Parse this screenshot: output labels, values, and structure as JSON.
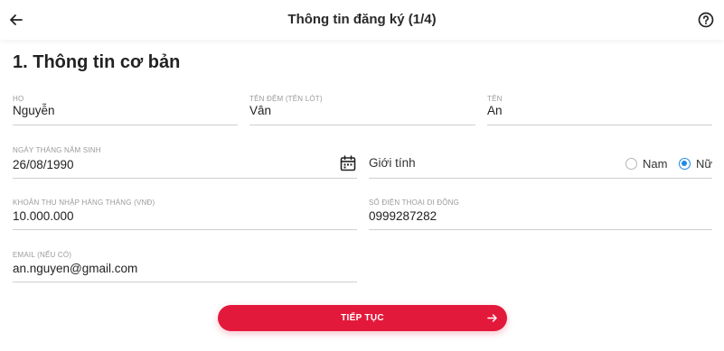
{
  "header": {
    "title": "Thông tin đăng ký (1/4)",
    "back_icon": "arrow-left-icon",
    "help_icon": "question-circle-icon"
  },
  "section": {
    "title": "1. Thông tin cơ bản"
  },
  "fields": {
    "last_name": {
      "label": "Họ",
      "value": "Nguyễn"
    },
    "middle_name": {
      "label": "Tên đệm (Tên lót)",
      "value": "Vân"
    },
    "first_name": {
      "label": "Tên",
      "value": "An"
    },
    "dob": {
      "label": "Ngày tháng năm sinh",
      "value": "26/08/1990",
      "icon": "calendar-icon"
    },
    "income": {
      "label": "Khoản thu nhập hàng tháng (VNĐ)",
      "value": "10.000.000"
    },
    "phone": {
      "label": "Số điện thoại di động",
      "value": "0999287282"
    },
    "email": {
      "label": "Email (nếu có)",
      "value": "an.nguyen@gmail.com"
    }
  },
  "gender": {
    "label": "Giới tính",
    "options": [
      {
        "label": "Nam",
        "selected": false
      },
      {
        "label": "Nữ",
        "selected": true
      }
    ],
    "accent_color": "#1e88e5"
  },
  "continue_button": {
    "label": "TIẾP TỤC",
    "icon": "arrow-right-icon",
    "color": "#e3193b"
  }
}
